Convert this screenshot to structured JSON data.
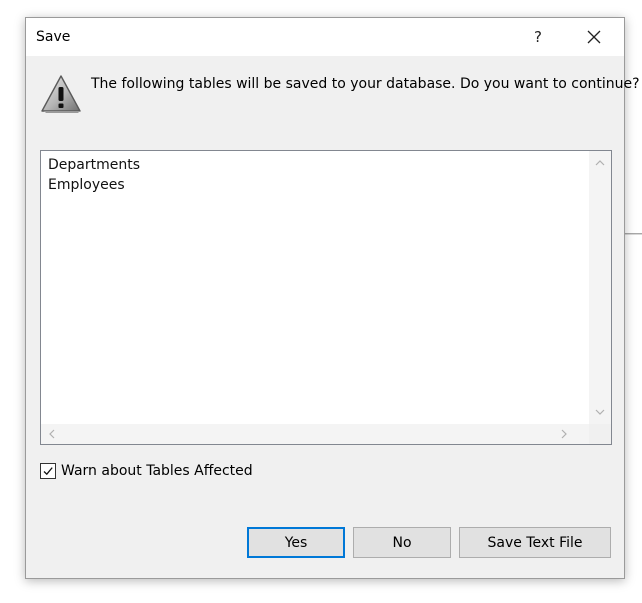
{
  "dialog": {
    "title": "Save",
    "help_label": "?",
    "message": "The following tables will be saved to your database. Do you want to continue?"
  },
  "tables": [
    "Departments",
    "Employees"
  ],
  "checkbox": {
    "label": "Warn about Tables Affected",
    "checked": true
  },
  "buttons": {
    "yes": "Yes",
    "no": "No",
    "save_text_file": "Save Text File"
  },
  "icons": {
    "warning": "warning-triangle-icon",
    "close": "close-icon",
    "scroll_up": "chevron-up-icon",
    "scroll_down": "chevron-down-icon",
    "scroll_left": "chevron-left-icon",
    "scroll_right": "chevron-right-icon",
    "check": "checkmark-icon"
  },
  "colors": {
    "default_button_border": "#0078d7",
    "dialog_bg": "#f0f0f0"
  }
}
